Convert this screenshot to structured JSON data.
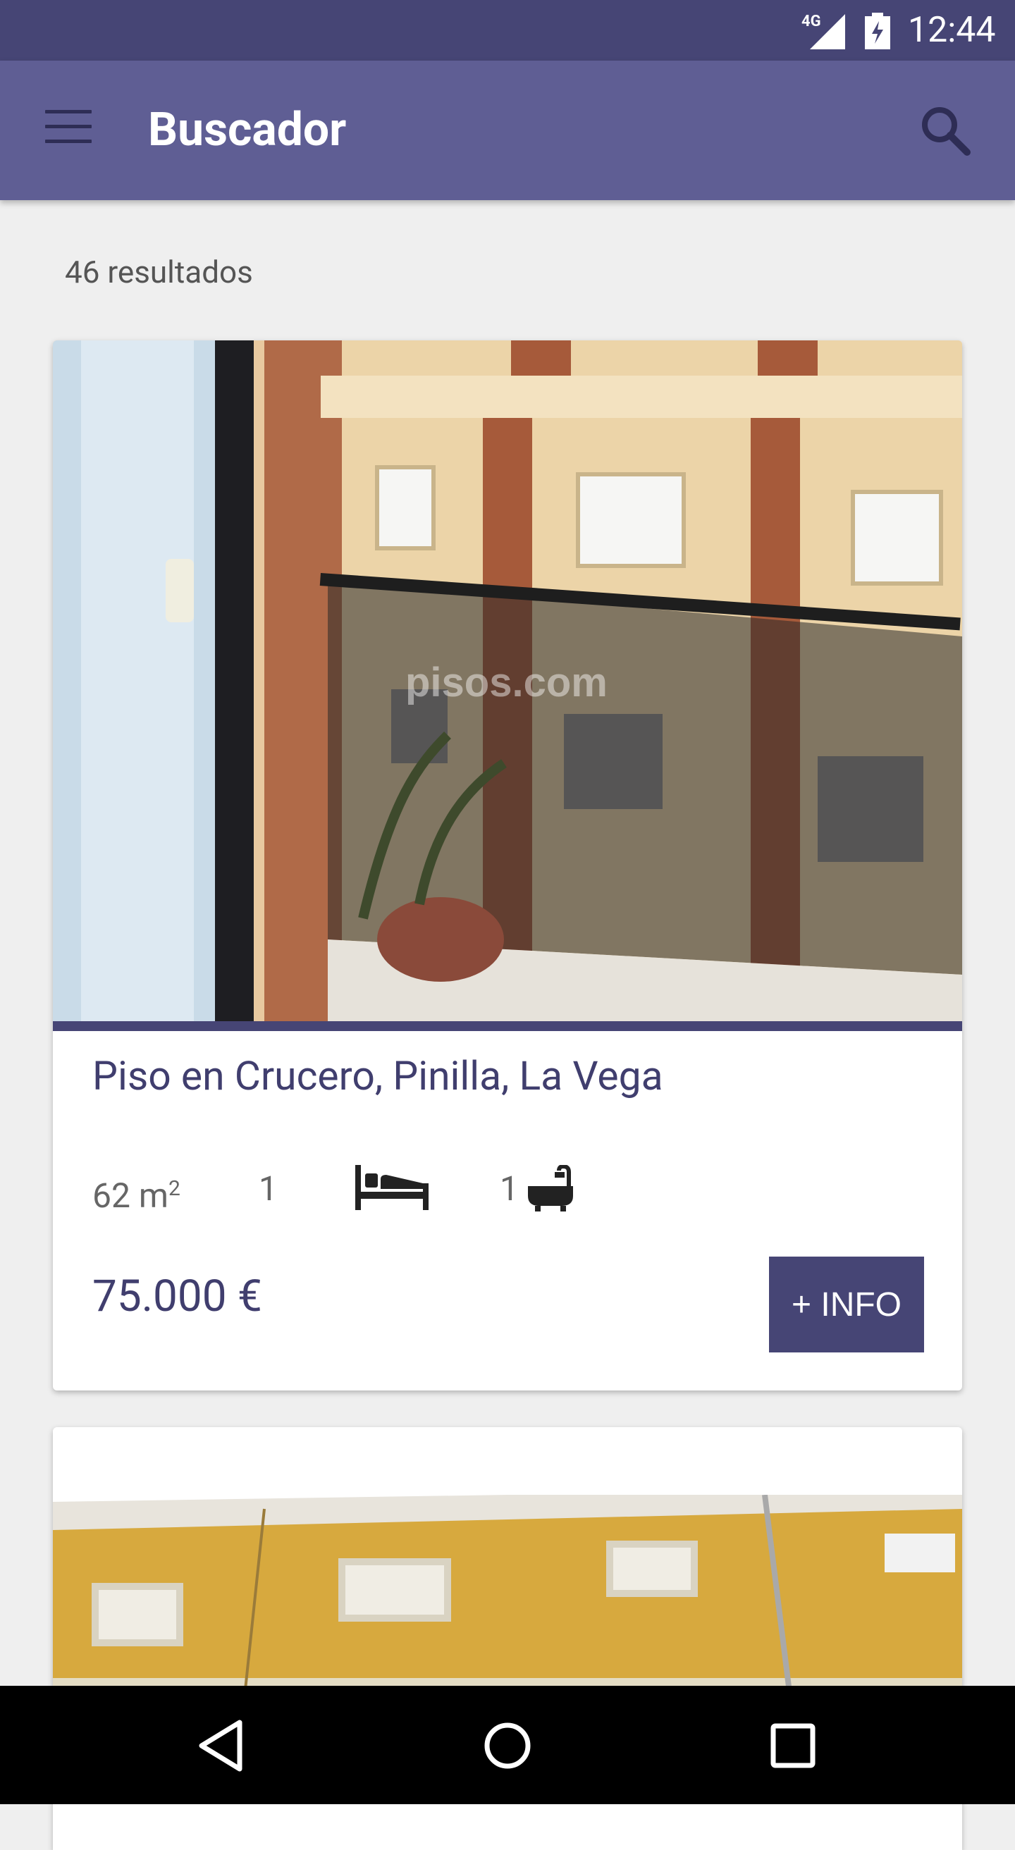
{
  "status_bar": {
    "network": "4G",
    "time": "12:44",
    "icons": [
      "signal-icon",
      "battery-charging-icon"
    ]
  },
  "app_bar": {
    "title": "Buscador",
    "icons": [
      "menu-icon",
      "search-icon"
    ]
  },
  "results": {
    "count_label": "46 resultados"
  },
  "listings": [
    {
      "title": "Piso en Crucero, Pinilla, La Vega",
      "area_value": "62 m",
      "area_unit_sup": "2",
      "bedrooms": "1",
      "bathrooms": "1",
      "price": "75.000 €",
      "info_button": "+ INFO",
      "watermark": "pisos.com"
    }
  ],
  "nav_bar": {
    "icons": [
      "back-icon",
      "home-icon",
      "recents-icon"
    ]
  },
  "colors": {
    "status_bar": "#464575",
    "app_bar": "#5f5e94",
    "accent": "#464575",
    "title_text": "#403e6e",
    "background": "#efefef"
  }
}
